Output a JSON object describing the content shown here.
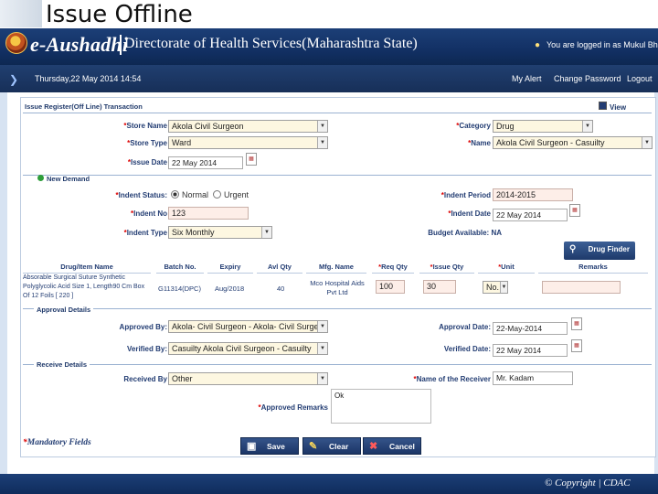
{
  "slide_title": "Issue Offline",
  "header": {
    "brand": "e-Aushadhi",
    "subtitle": "Directorate of Health Services(Maharashtra State)",
    "user_text": "You are logged in as Mukul Bhardwaj"
  },
  "nav": {
    "datetime": "Thursday,22 May 2014 14:54",
    "links": [
      "My Alert",
      "Change Password",
      "Logout"
    ]
  },
  "form": {
    "title": "Issue Register(Off Line) Transaction",
    "view_label": "View",
    "store_name": {
      "label": "Store Name",
      "value": "Akola  Civil Surgeon"
    },
    "store_type": {
      "label": "Store Type",
      "value": "Ward"
    },
    "issue_date": {
      "label": "Issue Date",
      "value": "22  May  2014"
    },
    "category": {
      "label": "Category",
      "value": "Drug"
    },
    "name": {
      "label": "Name",
      "value": "Akola Civil Surgeon - Casuilty"
    },
    "new_demand": "New Demand",
    "indent_status": {
      "label": "Indent Status",
      "options": [
        "Normal",
        "Urgent"
      ],
      "selected": "Normal"
    },
    "indent_no": {
      "label": "Indent No",
      "value": "123"
    },
    "indent_type": {
      "label": "Indent Type",
      "value": "Six Monthly"
    },
    "indent_period": {
      "label": "Indent Period",
      "value": "2014-2015"
    },
    "indent_date": {
      "label": "Indent Date",
      "value": "22 May 2014"
    },
    "budget": {
      "label": "Budget Available",
      "value": "NA"
    },
    "drug_finder": "Drug Finder",
    "table": {
      "headers": [
        "Drug/Item Name",
        "Batch No.",
        "Expiry",
        "Avl Qty",
        "Mfg. Name",
        "Req Qty",
        "Issue Qty",
        "Unit",
        "Remarks"
      ],
      "rows": [
        {
          "drug": "Absorable Surgical Suture Synthetic Polyglycolic Acid Size 1, Length90 Cm Box Of 12 Foils [ 220 ]",
          "batch": "G11314(DPC)",
          "expiry": "Aug/2018",
          "avl_qty": "40",
          "mfg": "Mco Hospital Aids Pvt Ltd",
          "req_qty": "100",
          "issue_qty": "30",
          "unit": "No.",
          "remarks": ""
        }
      ]
    },
    "approval_details": "Approval Details",
    "approved_by": {
      "label": "Approved By:",
      "value": "Akola- Civil Surgeon - Akola- Civil Surgeon"
    },
    "verified_by": {
      "label": "Verified By:",
      "value": "Casuilty    Akola Civil Surgeon  - Casuilty"
    },
    "approval_date": {
      "label": "Approval Date:",
      "value": "22-May-2014"
    },
    "verified_date": {
      "label": "Verified Date:",
      "value": "22 May 2014"
    },
    "receive_details": "Receive Details",
    "received_by": {
      "label": "Received By",
      "value": "Other"
    },
    "receiver_name": {
      "label": "Name of the Receiver",
      "value": "Mr. Kadam"
    },
    "approved_remarks": {
      "label": "Approved Remarks",
      "value": "Ok"
    },
    "mandatory": "Mandatory Fields",
    "buttons": {
      "save": "Save",
      "clear": "Clear",
      "cancel": "Cancel"
    }
  },
  "footer": "© Copyright | CDAC"
}
